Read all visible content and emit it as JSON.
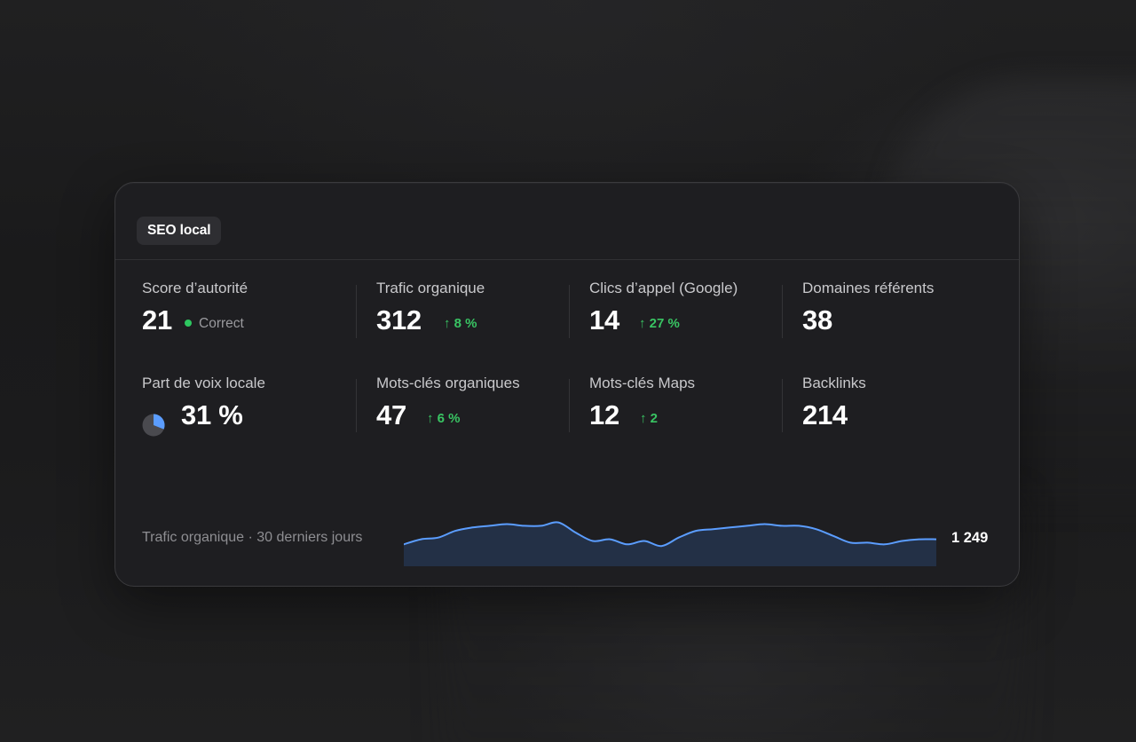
{
  "card": {
    "tag": "SEO local"
  },
  "metrics": {
    "authority": {
      "label": "Score d’autorité",
      "value": "21",
      "status": "Correct"
    },
    "organic_traffic": {
      "label": "Trafic organique",
      "value": "312",
      "delta": "↑ 8 %"
    },
    "call_clicks": {
      "label": "Clics d’appel (Google)",
      "value": "14",
      "delta": "↑ 27 %"
    },
    "referring_domains": {
      "label": "Domaines référents",
      "value": "38"
    },
    "share_of_voice": {
      "label": "Part de voix locale",
      "value": "31 %",
      "percent": 31
    },
    "organic_keywords": {
      "label": "Mots‑clés organiques",
      "value": "47",
      "delta": "↑ 6 %"
    },
    "maps_keywords": {
      "label": "Mots‑clés Maps",
      "value": "12",
      "delta": "↑ 2"
    },
    "backlinks": {
      "label": "Backlinks",
      "value": "214"
    }
  },
  "sparkline": {
    "label": "Trafic organique · 30 derniers jours",
    "total": "1 249"
  },
  "chart_data": {
    "type": "area",
    "values": [
      33,
      36,
      37,
      41,
      43,
      44,
      45,
      44,
      44,
      46,
      40,
      35,
      36,
      33,
      35,
      32,
      37,
      41,
      42,
      43,
      44,
      45,
      44,
      44,
      42,
      38,
      34,
      34,
      33,
      35,
      36,
      36
    ],
    "color": "#5b9dff"
  },
  "colors": {
    "accent_green": "#39c463",
    "status_dot": "#2ec760",
    "spark_line": "#5b9dff",
    "spark_fill": "#243249",
    "pie_fill": "#5b9dff",
    "pie_track": "#4a4a4f"
  }
}
